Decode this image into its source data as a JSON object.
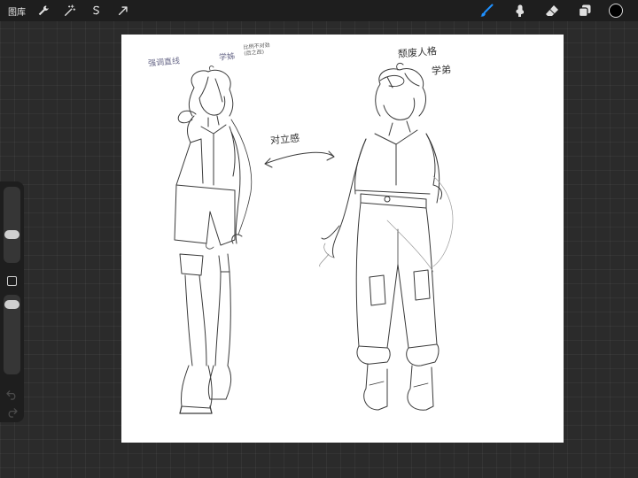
{
  "topbar": {
    "gallery_label": "图库",
    "left_tools": [
      {
        "name": "wrench-icon"
      },
      {
        "name": "magic-wand-icon"
      },
      {
        "name": "selection-icon"
      },
      {
        "name": "transform-arrow-icon"
      }
    ],
    "right_tools": [
      {
        "name": "brush-icon",
        "color": "#1e90ff"
      },
      {
        "name": "smudge-icon",
        "color": "#e0e0e0"
      },
      {
        "name": "eraser-icon",
        "color": "#e0e0e0"
      },
      {
        "name": "layers-icon",
        "color": "#e0e0e0"
      }
    ],
    "current_color": "#000000"
  },
  "sidebar": {
    "brush_size_level": 0.36,
    "opacity_level": 0.92
  },
  "canvas": {
    "notes": {
      "top_left": "强调直线",
      "top_left_2": "学姊",
      "top_left_small": "比例不对劲\n(后之改)",
      "middle": "对立感",
      "top_right": "颓废人格",
      "top_right_2": "学弟"
    }
  }
}
